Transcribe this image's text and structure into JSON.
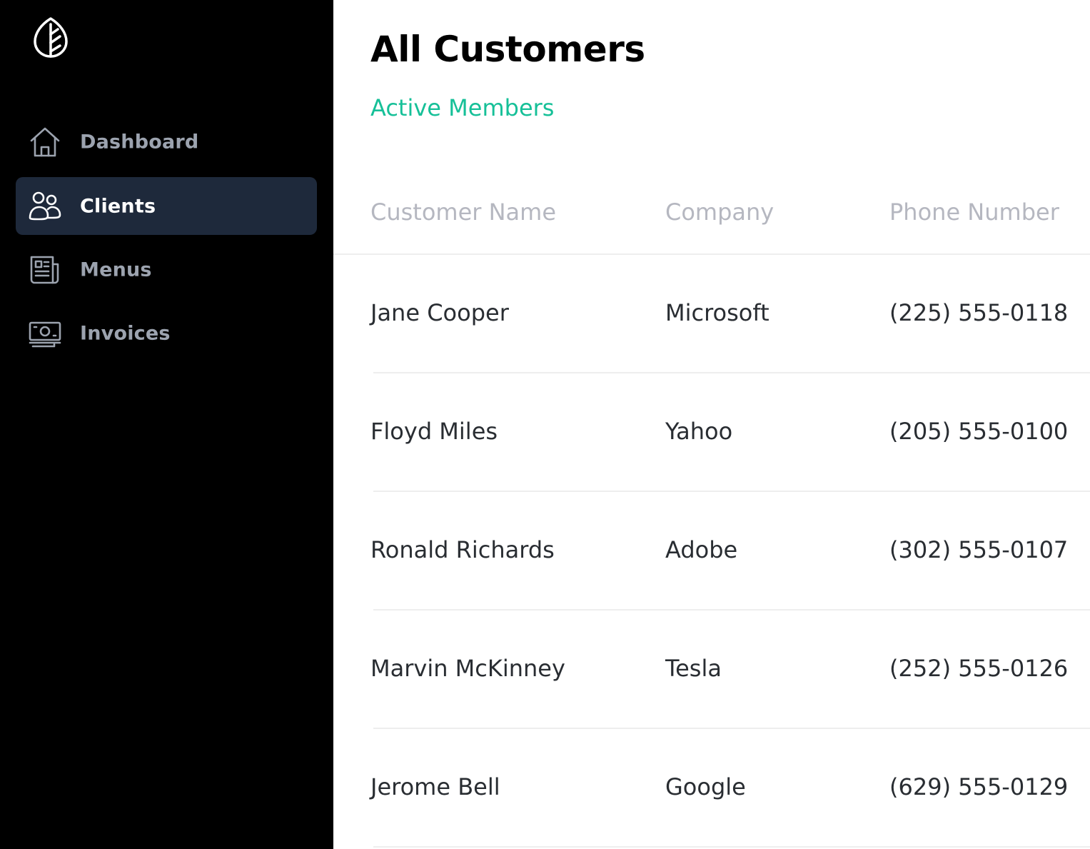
{
  "sidebar": {
    "logo_icon": "leaf-logo-icon",
    "items": [
      {
        "label": "Dashboard",
        "icon": "home-icon",
        "active": false
      },
      {
        "label": "Clients",
        "icon": "users-icon",
        "active": true
      },
      {
        "label": "Menus",
        "icon": "newspaper-icon",
        "active": false
      },
      {
        "label": "Invoices",
        "icon": "money-icon",
        "active": false
      }
    ],
    "active_bg": "#1e293b",
    "text_color": "#9ca3af"
  },
  "main": {
    "title": "All Customers",
    "subtitle": "Active Members",
    "accent_color": "#16c098",
    "table": {
      "columns": [
        "Customer Name",
        "Company",
        "Phone Number"
      ],
      "rows": [
        [
          "Jane Cooper",
          "Microsoft",
          "(225) 555-0118"
        ],
        [
          "Floyd Miles",
          "Yahoo",
          "(205) 555-0100"
        ],
        [
          "Ronald Richards",
          "Adobe",
          "(302) 555-0107"
        ],
        [
          "Marvin McKinney",
          "Tesla",
          "(252) 555-0126"
        ],
        [
          "Jerome Bell",
          "Google",
          "(629) 555-0129"
        ]
      ]
    }
  }
}
